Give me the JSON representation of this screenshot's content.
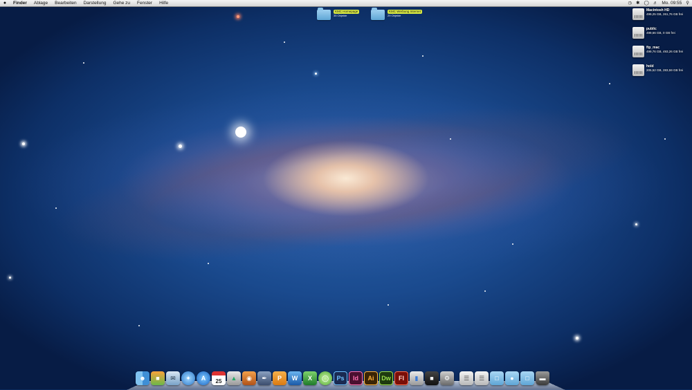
{
  "menubar": {
    "apple": "",
    "app": "Finder",
    "menus": [
      "Ablage",
      "Bearbeiten",
      "Darstellung",
      "Gehe zu",
      "Fenster",
      "Hilfe"
    ],
    "status": {
      "clock": "Mo. 09:55"
    }
  },
  "desktop_folders": [
    {
      "name": "KMC Homepage",
      "sub": "35 Objekte"
    },
    {
      "name": "KMC Werbung Internet",
      "sub": "29 Objekte"
    }
  ],
  "drives": [
    {
      "name": "Macintosh HD",
      "info": "499,25 GB, 261,76 GB frei"
    },
    {
      "name": "public",
      "info": "499,66 GB, 0 GB frei"
    },
    {
      "name": "ftp_mac",
      "info": "499,76 GB, 493,26 GB frei"
    },
    {
      "name": "hold",
      "info": "205,52 GB, 283,59 GB frei"
    }
  ],
  "dock": {
    "calendar_day": "25",
    "adobe": [
      "Ps",
      "Id",
      "Ai",
      "Dw",
      "Fl"
    ],
    "colors": {
      "ps": "#1a2a52",
      "id": "#4a1030",
      "ai": "#3a2405",
      "dw": "#1e3a10",
      "fl": "#7a0e08"
    }
  }
}
